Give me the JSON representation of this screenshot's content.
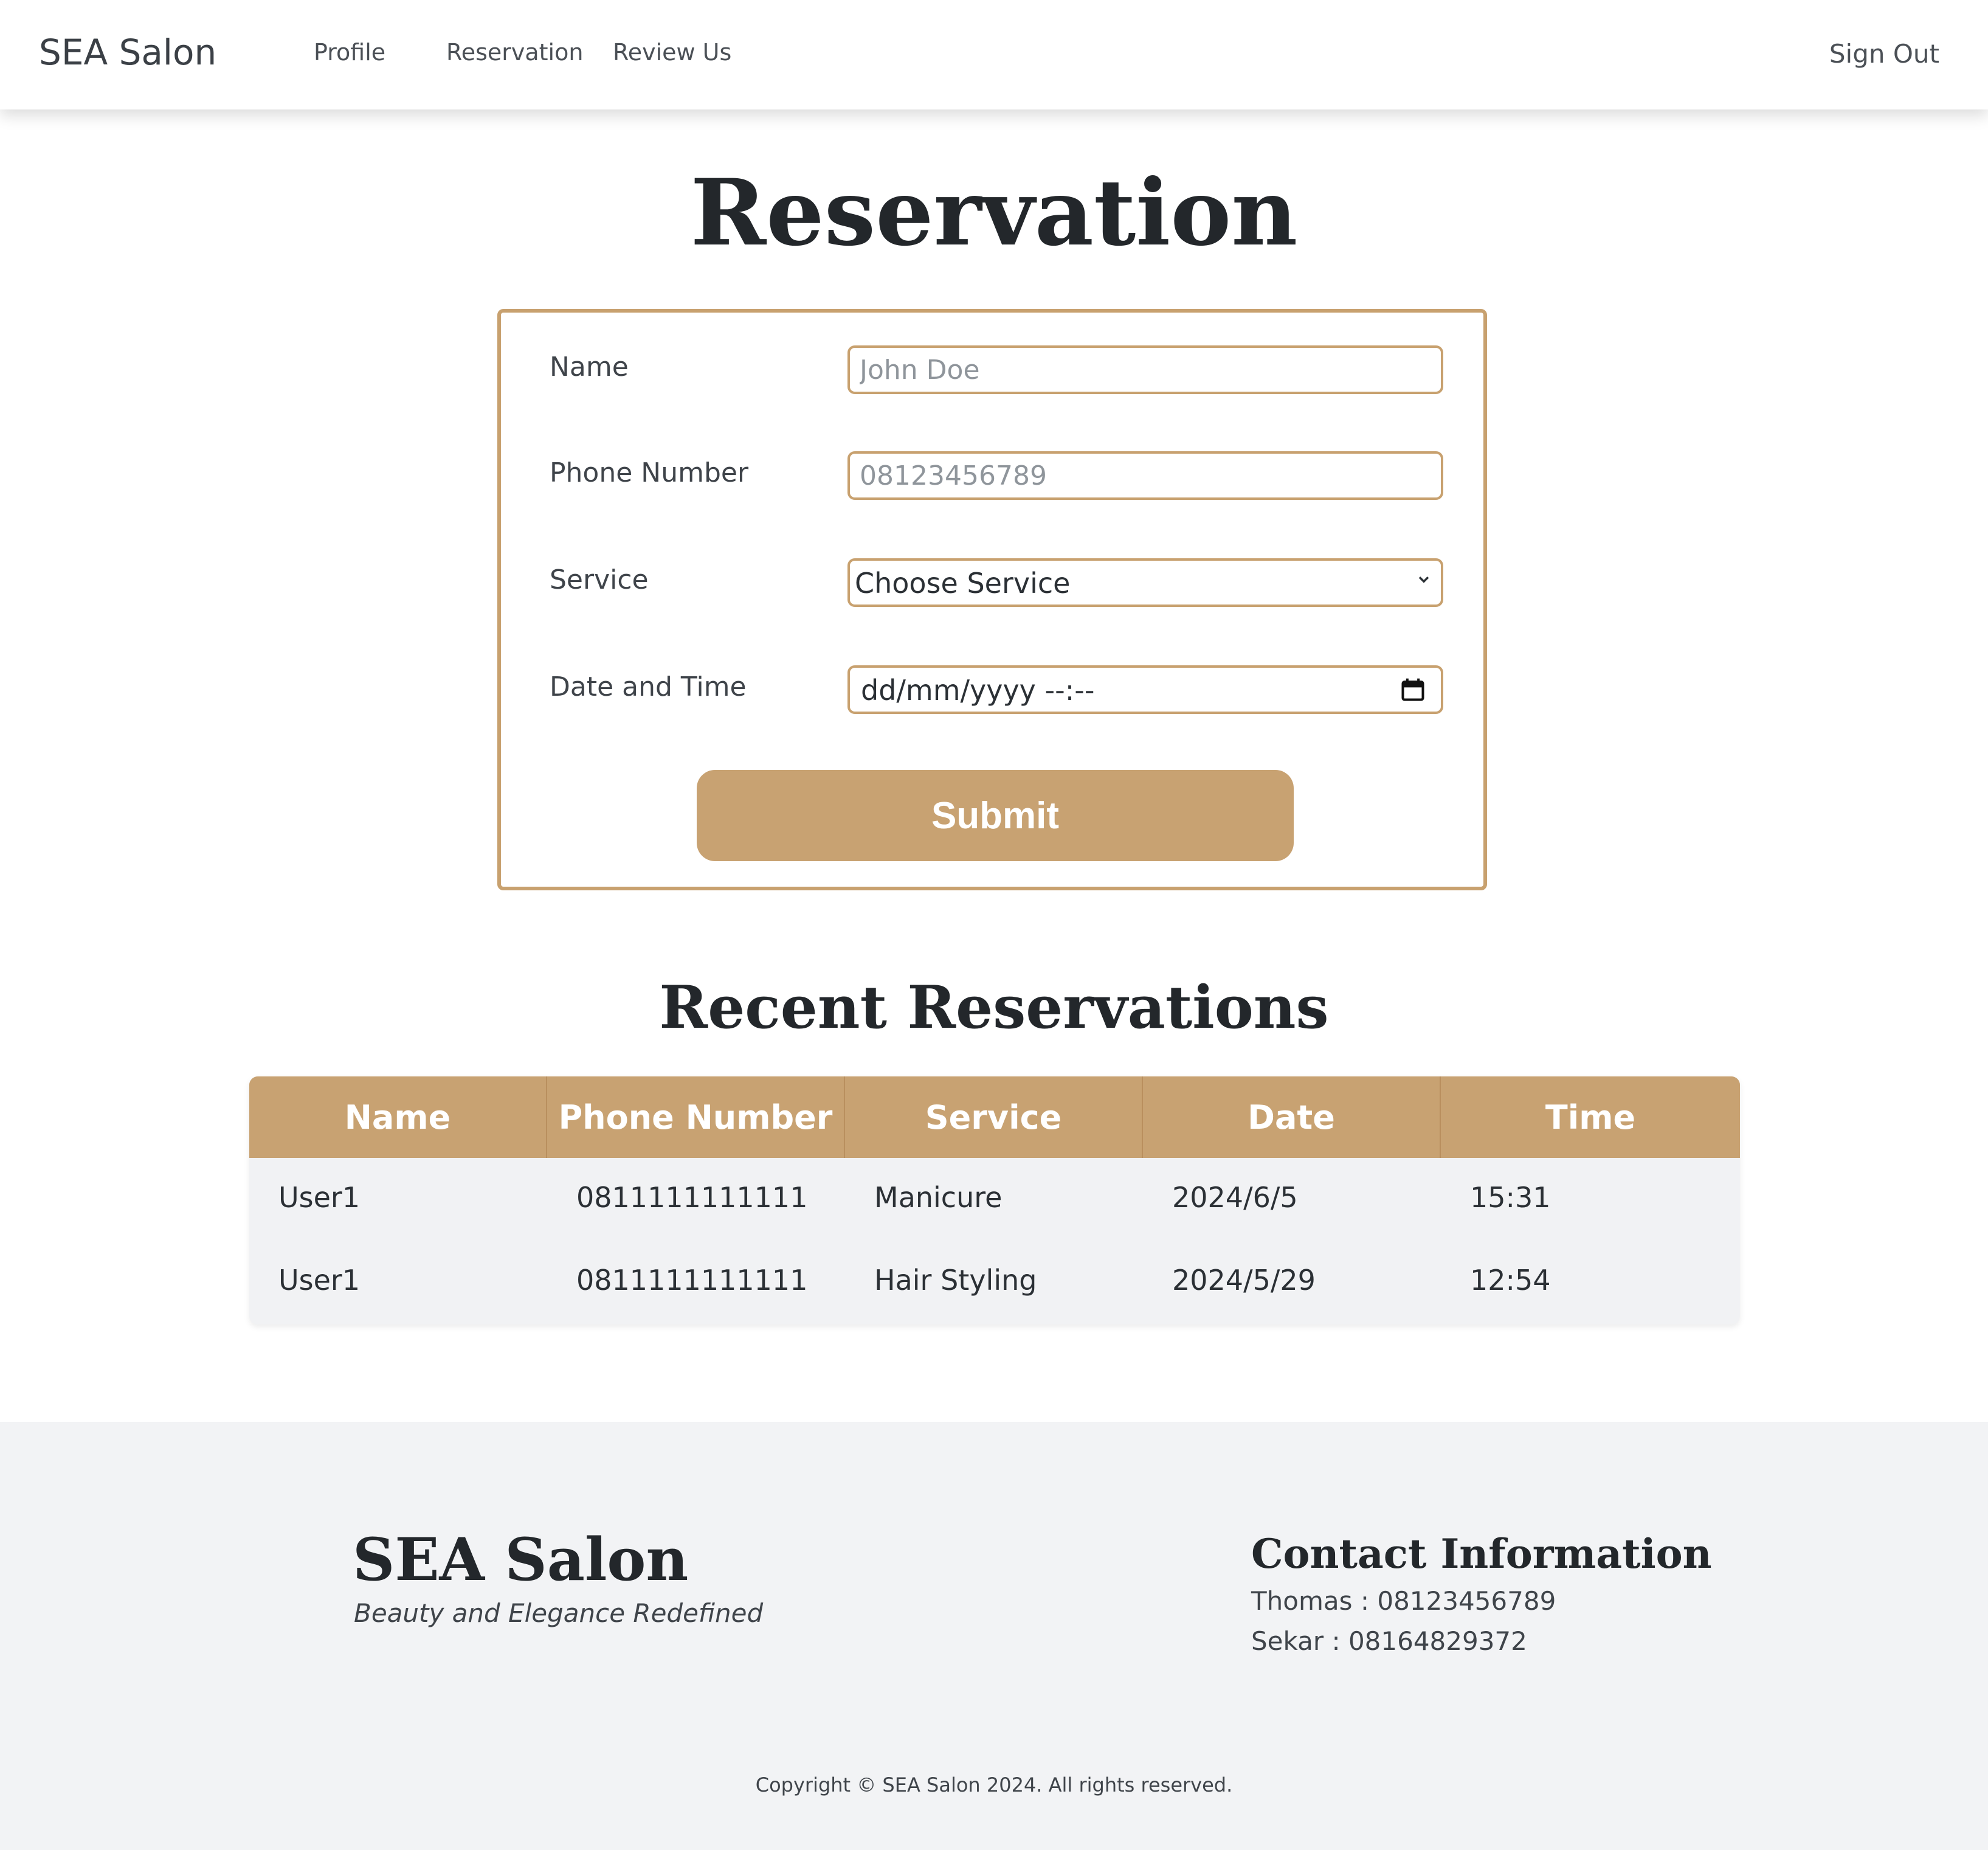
{
  "navbar": {
    "brand": "SEA Salon",
    "links": [
      "Profile",
      "Reservation",
      "Review Us"
    ],
    "sign_out": "Sign Out"
  },
  "page": {
    "title": "Reservation"
  },
  "form": {
    "name_label": "Name",
    "name_placeholder": "John Doe",
    "phone_label": "Phone Number",
    "phone_placeholder": "08123456789",
    "service_label": "Service",
    "service_selected": "Choose Service",
    "datetime_label": "Date and Time",
    "datetime_placeholder": "dd/mm/yyyy --:--",
    "submit_label": "Submit"
  },
  "recent": {
    "title": "Recent Reservations",
    "columns": [
      "Name",
      "Phone Number",
      "Service",
      "Date",
      "Time"
    ],
    "rows": [
      [
        "User1",
        "0811111111111",
        "Manicure",
        "2024/6/5",
        "15:31"
      ],
      [
        "User1",
        "0811111111111",
        "Hair Styling",
        "2024/5/29",
        "12:54"
      ]
    ]
  },
  "footer": {
    "brand": "SEA Salon",
    "tagline": "Beauty and Elegance Redefined",
    "contact_title": "Contact Information",
    "contacts": [
      "Thomas : 08123456789",
      "Sekar : 08164829372"
    ],
    "copyright": "Copyright © SEA Salon 2024. All rights reserved."
  },
  "colors": {
    "accent": "#c8a272",
    "border": "#c8a16f",
    "footer_bg": "#f2f3f5"
  },
  "icons": {
    "select": "chevron-down-icon",
    "datetime": "calendar-icon"
  }
}
